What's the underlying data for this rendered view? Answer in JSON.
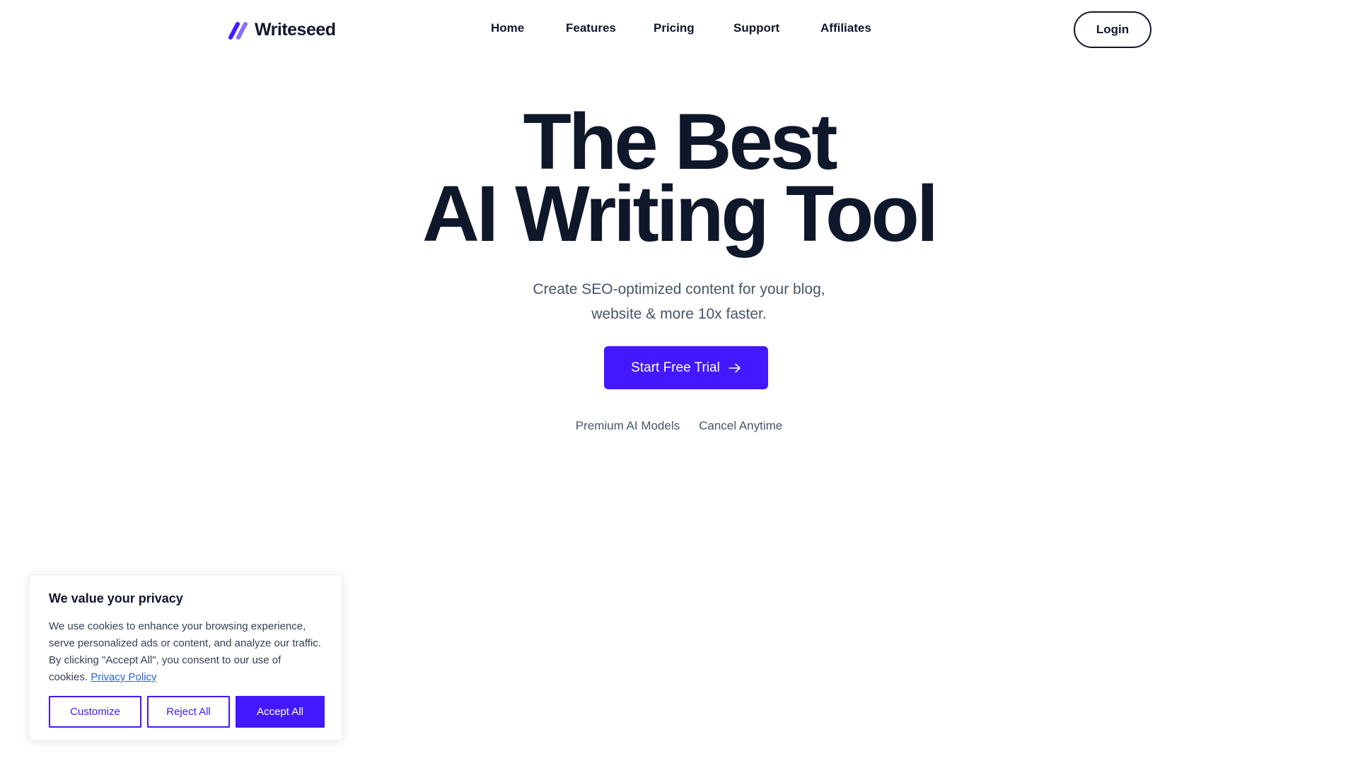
{
  "header": {
    "logo_text": "Writeseed",
    "nav": [
      {
        "label": "Home"
      },
      {
        "label": "Features"
      },
      {
        "label": "Pricing"
      },
      {
        "label": "Support"
      },
      {
        "label": "Affiliates"
      }
    ],
    "login_label": "Login"
  },
  "hero": {
    "title_line1": "The Best",
    "title_line2": "AI Writing Tool",
    "subtitle_line1": "Create SEO-optimized content for your blog,",
    "subtitle_line2": "website & more 10x faster.",
    "cta_label": "Start Free Trial",
    "badges": [
      "Premium AI Models",
      "Cancel Anytime"
    ]
  },
  "cookie_banner": {
    "title": "We value your privacy",
    "text": "We use cookies to enhance your browsing experience, serve personalized ads or content, and analyze our traffic. By clicking \"Accept All\", you consent to our use of cookies.",
    "link_label": "Privacy Policy",
    "customize_label": "Customize",
    "reject_label": "Reject All",
    "accept_label": "Accept All"
  },
  "colors": {
    "brand": "#4318ff",
    "text_dark": "#0f172a",
    "text_muted": "#475569",
    "link": "#2563eb"
  },
  "icons": {
    "logo": "writeseed-slash-logo-icon",
    "cta": "arrow-right-icon"
  }
}
